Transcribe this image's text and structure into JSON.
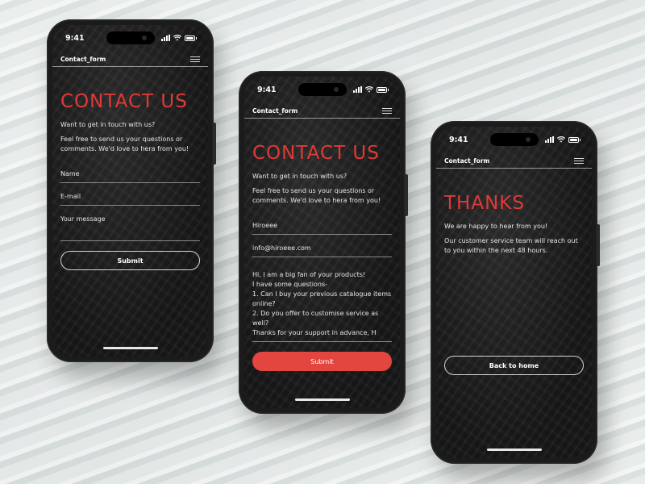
{
  "colors": {
    "accent": "#e03a36",
    "button_fill": "#e2463f",
    "screen_bg": "#1c1c1d"
  },
  "phones": [
    {
      "time": "9:41",
      "app_title": "Contact_form",
      "heading": "CONTACT US",
      "intro": "Want to get in touch with us?",
      "body": "Feel free to send us your questions or comments. We'd love to hera from you!",
      "name_placeholder": "Name",
      "email_placeholder": "E-mail",
      "message_placeholder": "Your message",
      "submit_label": "Submit"
    },
    {
      "time": "9:41",
      "app_title": "Contact_form",
      "heading": "CONTACT US",
      "intro": "Want to get in touch with us?",
      "body": "Feel free to send us your questions or comments. We'd love to hera from you!",
      "name_value": "Hiroeee",
      "email_value": "info@hiroeee.com",
      "message_lines": [
        "Hi, I am a big fan of your products!",
        "I have some questions-",
        "1. Can I buy your previous catalogue items online?",
        "2. Do you offer to customise service as well?",
        "Thanks for your support in advance, H"
      ],
      "submit_label": "Submit"
    },
    {
      "time": "9:41",
      "app_title": "Contact_form",
      "heading": "THANKS",
      "intro": "We are happy to hear from you!",
      "body": "Our customer service team will reach out to you within the next 48 hours.",
      "back_label": "Back to home"
    }
  ],
  "icons": [
    "cellular-signal-icon",
    "wifi-icon",
    "battery-icon",
    "hamburger-menu-icon"
  ]
}
